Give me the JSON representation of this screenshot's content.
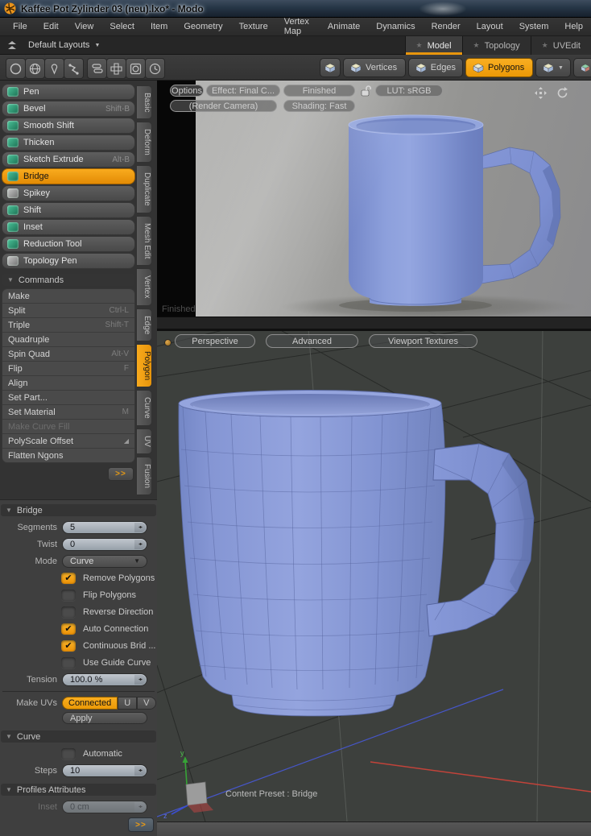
{
  "window": {
    "title": "Kaffee Pot Zylinder 03 (neu).lxo* - Modo"
  },
  "menubar": {
    "items": [
      "File",
      "Edit",
      "View",
      "Select",
      "Item",
      "Geometry",
      "Texture",
      "Vertex Map",
      "Animate",
      "Dynamics",
      "Render",
      "Layout",
      "System",
      "Help"
    ]
  },
  "layout_bar": {
    "preset_label": "Default Layouts",
    "tabs": [
      {
        "label": "Model",
        "active": true
      },
      {
        "label": "Topology",
        "active": false
      },
      {
        "label": "UVEdit",
        "active": false
      }
    ]
  },
  "mode_bar": {
    "buttons": [
      {
        "label": "Vertices",
        "active": false
      },
      {
        "label": "Edges",
        "active": false
      },
      {
        "label": "Polygons",
        "active": true
      }
    ]
  },
  "tool_panel": {
    "tools": [
      {
        "label": "Pen",
        "shortcut": ""
      },
      {
        "label": "Bevel",
        "shortcut": "Shift-B"
      },
      {
        "label": "Smooth Shift",
        "shortcut": ""
      },
      {
        "label": "Thicken",
        "shortcut": ""
      },
      {
        "label": "Sketch Extrude",
        "shortcut": "Alt-B"
      },
      {
        "label": "Bridge",
        "shortcut": "",
        "active": true
      },
      {
        "label": "Spikey",
        "shortcut": ""
      },
      {
        "label": "Shift",
        "shortcut": ""
      },
      {
        "label": "Inset",
        "shortcut": ""
      },
      {
        "label": "Reduction Tool",
        "shortcut": ""
      },
      {
        "label": "Topology Pen",
        "shortcut": ""
      }
    ],
    "commands_header": "Commands",
    "commands": [
      {
        "label": "Make",
        "shortcut": ""
      },
      {
        "label": "Split",
        "shortcut": "Ctrl-L"
      },
      {
        "label": "Triple",
        "shortcut": "Shift-T"
      },
      {
        "label": "Quadruple",
        "shortcut": ""
      },
      {
        "label": "Spin Quad",
        "shortcut": "Alt-V"
      },
      {
        "label": "Flip",
        "shortcut": "F"
      },
      {
        "label": "Align",
        "shortcut": ""
      },
      {
        "label": "Set Part...",
        "shortcut": ""
      },
      {
        "label": "Set Material",
        "shortcut": "M"
      },
      {
        "label": "Make Curve Fill",
        "shortcut": "",
        "disabled": true
      },
      {
        "label": "PolyScale Offset",
        "shortcut": ""
      },
      {
        "label": "Flatten Ngons",
        "shortcut": ""
      }
    ],
    "more_label": ">>",
    "tabs": [
      {
        "label": "Basic"
      },
      {
        "label": "Deform"
      },
      {
        "label": "Duplicate"
      },
      {
        "label": "Mesh Edit"
      },
      {
        "label": "Vertex"
      },
      {
        "label": "Edge"
      },
      {
        "label": "Polygon",
        "active": true
      },
      {
        "label": "Curve"
      },
      {
        "label": "UV"
      },
      {
        "label": "Fusion"
      }
    ]
  },
  "properties": {
    "bridge": {
      "header": "Bridge",
      "segments_label": "Segments",
      "segments_value": "5",
      "twist_label": "Twist",
      "twist_value": "0",
      "mode_label": "Mode",
      "mode_value": "Curve",
      "checkboxes": [
        {
          "label": "Remove Polygons",
          "checked": true
        },
        {
          "label": "Flip Polygons",
          "checked": false
        },
        {
          "label": "Reverse Direction",
          "checked": false
        },
        {
          "label": "Auto Connection",
          "checked": true
        },
        {
          "label": "Continuous Brid ...",
          "checked": true
        },
        {
          "label": "Use Guide Curve",
          "checked": false
        }
      ],
      "tension_label": "Tension",
      "tension_value": "100.0 %",
      "make_uvs_label": "Make UVs",
      "make_uvs_options": [
        {
          "label": "Connected",
          "active": true
        },
        {
          "label": "U",
          "active": false
        },
        {
          "label": "V",
          "active": false
        }
      ],
      "apply_label": "Apply"
    },
    "curve": {
      "header": "Curve",
      "automatic_label": "Automatic",
      "automatic_checked": false,
      "steps_label": "Steps",
      "steps_value": "10"
    },
    "profiles": {
      "header": "Profiles Attributes",
      "inset_label": "Inset",
      "inset_value": "0 cm",
      "inset_disabled": true
    },
    "more_label": ">>"
  },
  "render_view": {
    "buttons_row1": [
      {
        "label": "Options"
      },
      {
        "label": "Effect: Final C..."
      },
      {
        "label": "Finished"
      },
      {
        "label": "LUT: sRGB"
      }
    ],
    "buttons_row2": [
      {
        "label": "(Render Camera)"
      },
      {
        "label": "Shading: Fast"
      }
    ],
    "status": "Finished"
  },
  "viewport": {
    "buttons": [
      {
        "label": "Perspective"
      },
      {
        "label": "Advanced"
      },
      {
        "label": "Viewport Textures"
      }
    ],
    "status": "Content Preset : Bridge"
  },
  "icons": {
    "star": "★",
    "check": "✔",
    "stepper": "◂▸",
    "dropdown": "▼",
    "section_tri": "▼",
    "submenu": "◢"
  },
  "colors": {
    "accent_orange": "#f09819",
    "mug_blue": "#8496d4",
    "viewport_bg": "#3e403e",
    "render_bg": "#9b9b99",
    "axis_red": "#c2433a",
    "axis_blue": "#4656c8",
    "axis_green": "#3faa3f"
  }
}
